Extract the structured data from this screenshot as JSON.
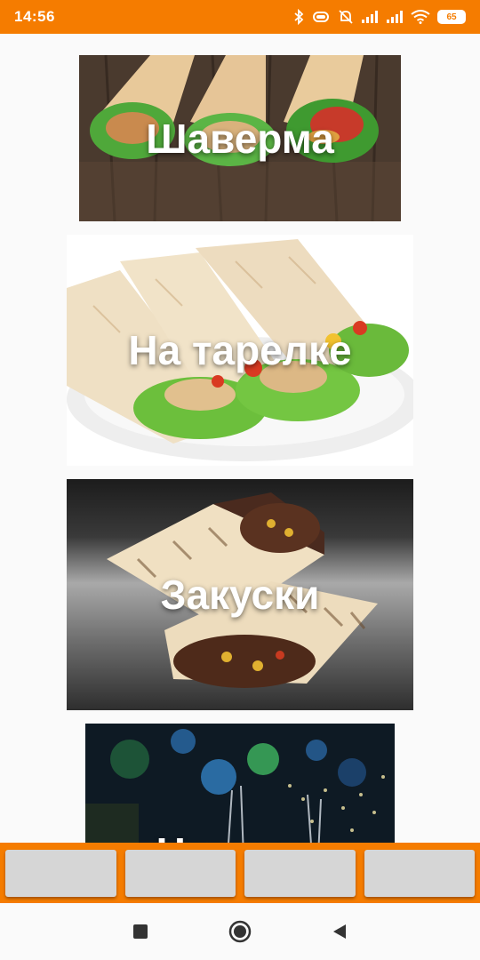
{
  "status_bar": {
    "time": "14:56",
    "battery": "65",
    "icons": [
      "bluetooth-icon",
      "vibrate-icon",
      "mute-icon",
      "signal-icon",
      "signal-icon",
      "wifi-icon",
      "battery-icon"
    ]
  },
  "menu": {
    "items": [
      {
        "label": "Шаверма"
      },
      {
        "label": "На тарелке"
      },
      {
        "label": "Закуски"
      },
      {
        "label": "Напитки"
      }
    ]
  },
  "bottom_bar": {
    "buttons": [
      "",
      "",
      "",
      ""
    ]
  },
  "nav": {
    "icons": [
      "recents-icon",
      "home-icon",
      "back-icon"
    ]
  },
  "colors": {
    "accent": "#f57c00",
    "button": "#d6d6d6",
    "background": "#fafafa"
  }
}
